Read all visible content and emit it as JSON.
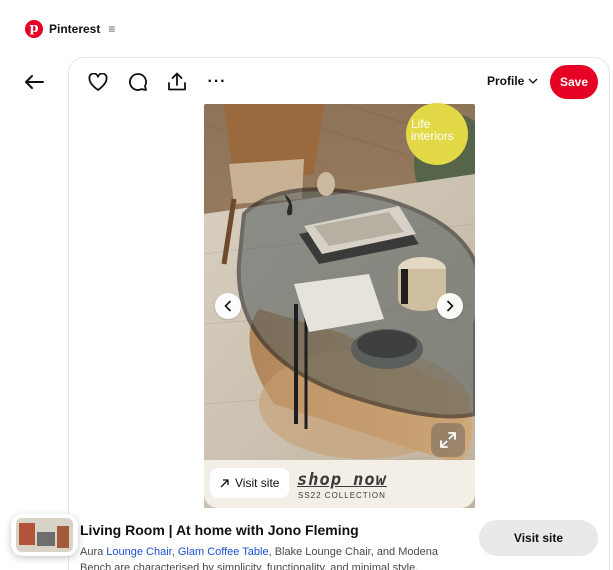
{
  "brand": {
    "name": "Pinterest",
    "menu_glyph": "≡",
    "logo_letter": "p",
    "color": "#e60023"
  },
  "toolbar": {
    "icons": [
      "heart-icon",
      "comment-icon",
      "share-icon",
      "more-icon"
    ],
    "more_glyph": "···",
    "profile_label": "Profile",
    "save_label": "Save"
  },
  "pin": {
    "logo_line1": "Life",
    "logo_line2": "interiors",
    "visit_chip_label": "Visit site",
    "shop_now": "shop now",
    "collection": "SS22 COLLECTION",
    "image_count_dots": 0
  },
  "details": {
    "title": "Living Room | At home with Jono Fleming",
    "desc_pre": "Aura ",
    "link1": "Lounge Chair",
    "desc_sep": ", ",
    "link2": "Glam Coffee Table",
    "desc_post": ", Blake Lounge Chair, and Modena Bench are characterised by simplicity, functionality, and minimal style.",
    "visit_button": "Visit site"
  },
  "colors": {
    "accent": "#e60023",
    "link": "#1e4fd8",
    "logo_badge": "#e3d845"
  }
}
